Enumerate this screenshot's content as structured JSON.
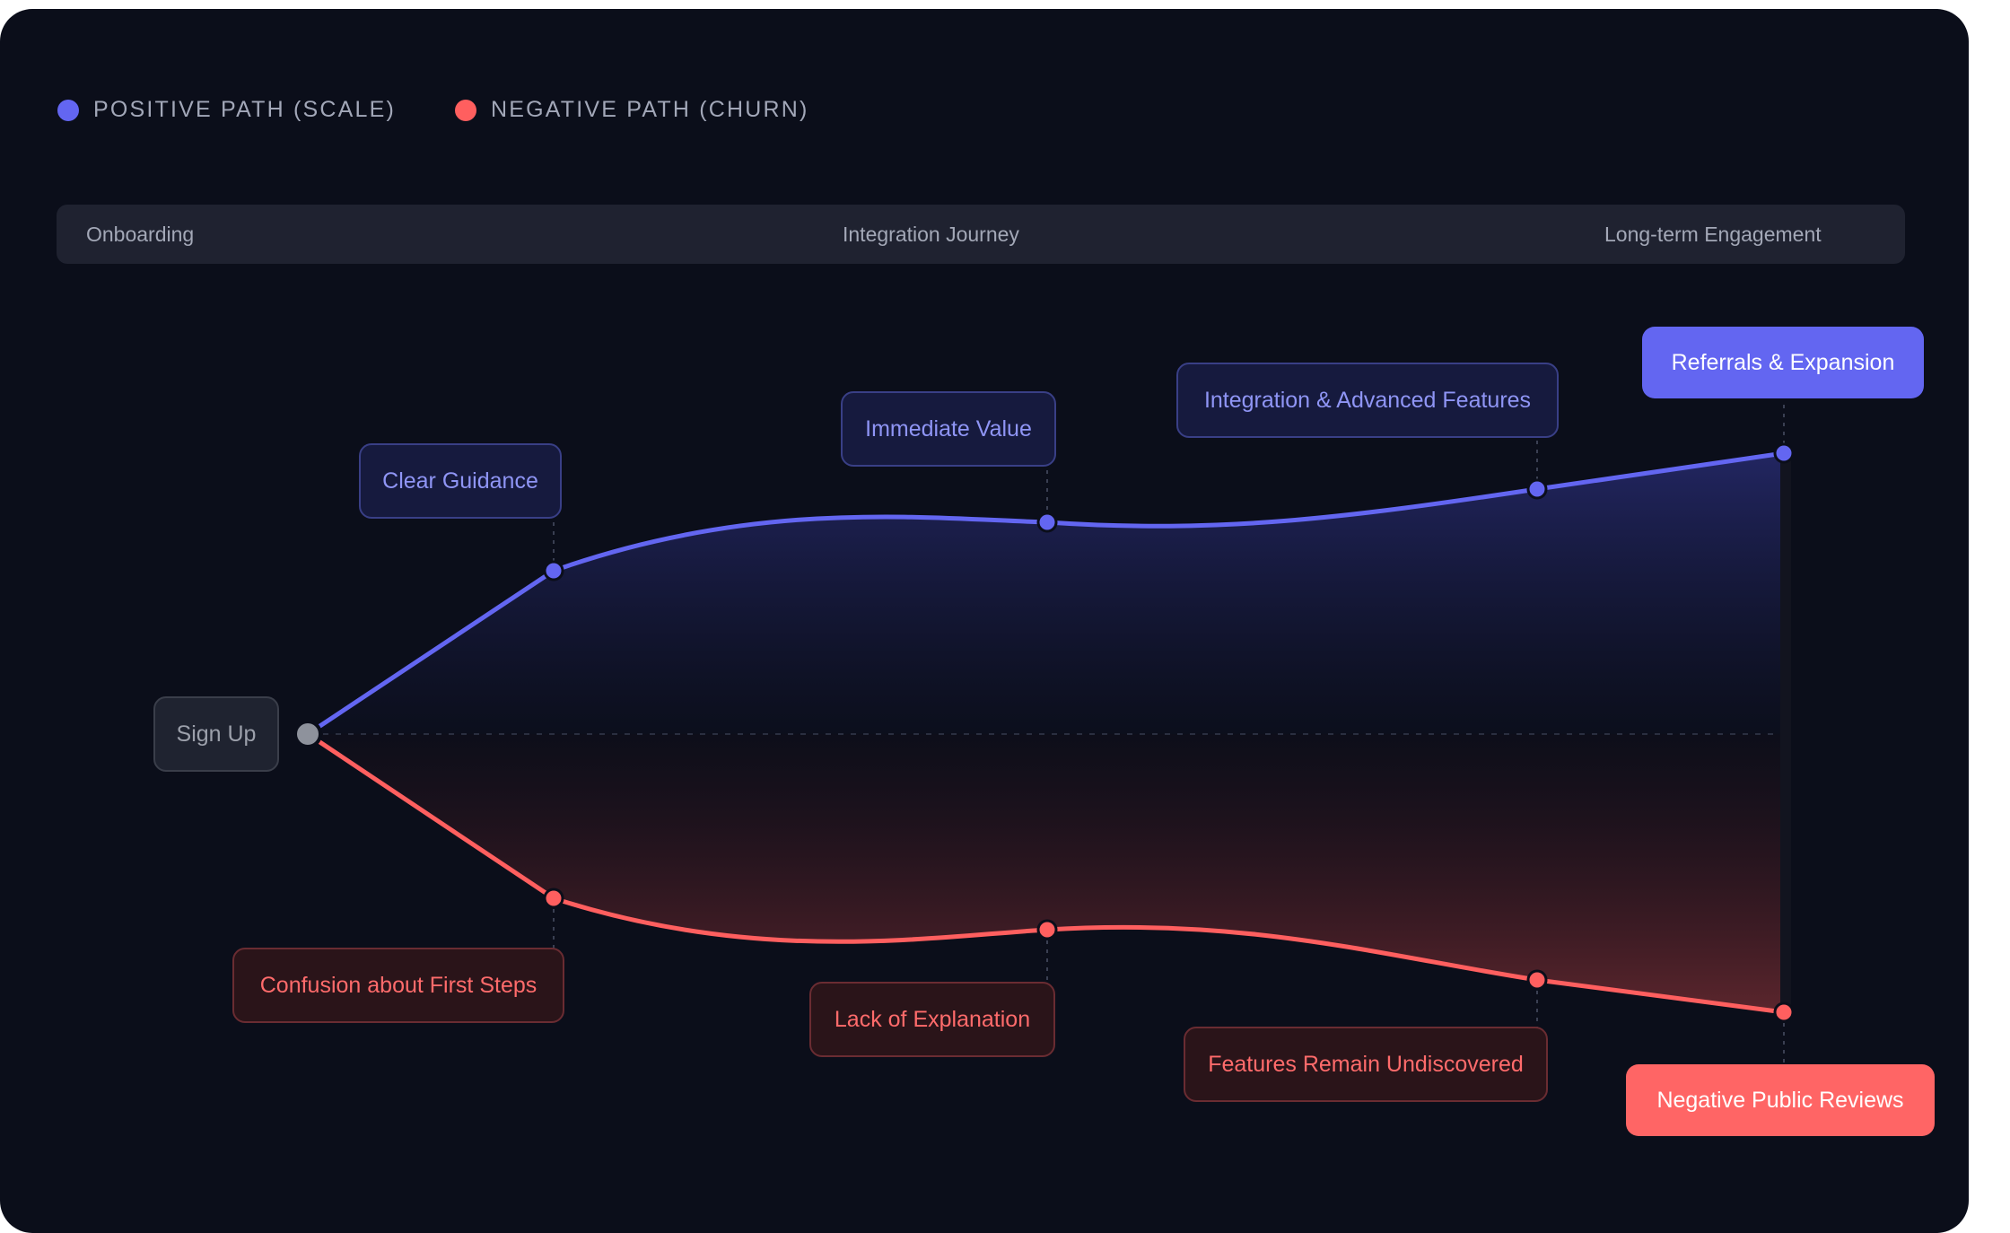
{
  "legend": [
    {
      "label": "POSITIVE PATH (SCALE)",
      "color": "#6366f1"
    },
    {
      "label": "NEGATIVE PATH (CHURN)",
      "color": "#ff5f5f"
    }
  ],
  "phases": [
    "Onboarding",
    "Integration Journey",
    "Long-term Engagement"
  ],
  "start_node": {
    "label": "Sign Up"
  },
  "positive_path": {
    "color": "#6366f1",
    "steps": [
      {
        "label": "Clear Guidance"
      },
      {
        "label": "Immediate Value"
      },
      {
        "label": "Integration & Advanced Features"
      },
      {
        "label": "Referrals & Expansion"
      }
    ]
  },
  "negative_path": {
    "color": "#ff5f5f",
    "steps": [
      {
        "label": "Confusion about First Steps"
      },
      {
        "label": "Lack of Explanation"
      },
      {
        "label": "Features Remain Undiscovered"
      },
      {
        "label": "Negative Public Reviews"
      }
    ]
  }
}
